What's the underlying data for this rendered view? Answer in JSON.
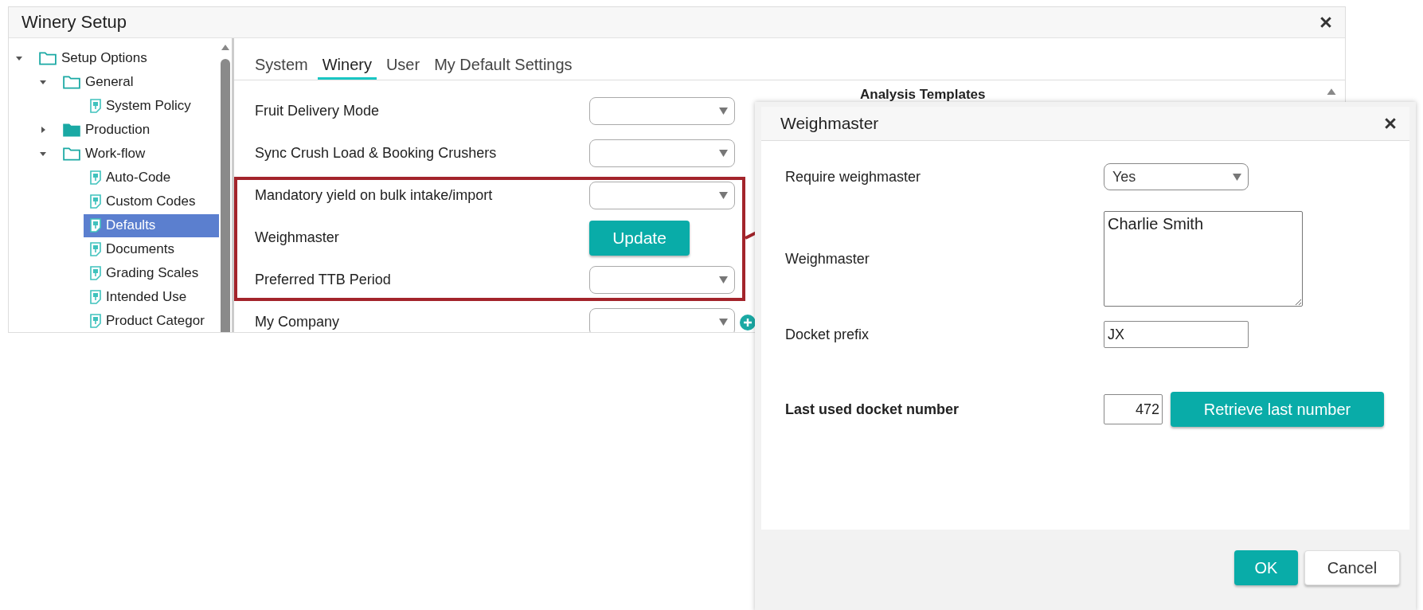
{
  "window": {
    "title": "Winery Setup"
  },
  "tree": [
    {
      "label": "Setup Options",
      "kind": "folder",
      "expanded": true,
      "selected": false,
      "children": [
        {
          "label": "General",
          "kind": "folder",
          "expanded": true,
          "selected": false,
          "children": [
            {
              "label": "System Policy",
              "kind": "page",
              "selected": false
            }
          ]
        },
        {
          "label": "Production",
          "kind": "folder",
          "expanded": false,
          "selected": false
        },
        {
          "label": "Work-flow",
          "kind": "folder",
          "expanded": true,
          "selected": false,
          "children": [
            {
              "label": "Auto-Code",
              "kind": "page",
              "selected": false
            },
            {
              "label": "Custom Codes",
              "kind": "page",
              "selected": false
            },
            {
              "label": "Defaults",
              "kind": "page",
              "selected": true
            },
            {
              "label": "Documents",
              "kind": "page",
              "selected": false
            },
            {
              "label": "Grading Scales",
              "kind": "page",
              "selected": false
            },
            {
              "label": "Intended Use",
              "kind": "page",
              "selected": false
            },
            {
              "label": "Product Categor",
              "kind": "page",
              "selected": false
            }
          ]
        }
      ]
    }
  ],
  "tabs": [
    {
      "label": "System",
      "selected": false
    },
    {
      "label": "Winery",
      "selected": true
    },
    {
      "label": "User",
      "selected": false
    },
    {
      "label": "My Default Settings",
      "selected": false
    }
  ],
  "settings": [
    {
      "label": "Fruit Delivery Mode",
      "kind": "select"
    },
    {
      "label": "Sync Crush Load & Booking Crushers",
      "kind": "select"
    },
    {
      "label": "Mandatory yield on bulk intake/import",
      "kind": "select"
    },
    {
      "label": "Weighmaster",
      "kind": "button",
      "button": "Update"
    },
    {
      "label": "Preferred TTB Period",
      "kind": "select"
    },
    {
      "label": "My Company",
      "kind": "select_add"
    }
  ],
  "side_panel": {
    "heading": "Analysis Templates"
  },
  "dialog": {
    "title": "Weighmaster",
    "fields": [
      {
        "label": "Require weighmaster",
        "kind": "select",
        "value": "Yes"
      },
      {
        "label": "Weighmaster",
        "kind": "textarea",
        "value": "Charlie Smith"
      },
      {
        "label": "Docket prefix",
        "kind": "input",
        "value": "JX"
      },
      {
        "label": "Last used docket number",
        "kind": "number",
        "value": "472",
        "button": "Retrieve last number"
      }
    ],
    "buttons": [
      {
        "label": "OK",
        "kind": "primary"
      },
      {
        "label": "Cancel",
        "kind": "secondary"
      }
    ]
  }
}
